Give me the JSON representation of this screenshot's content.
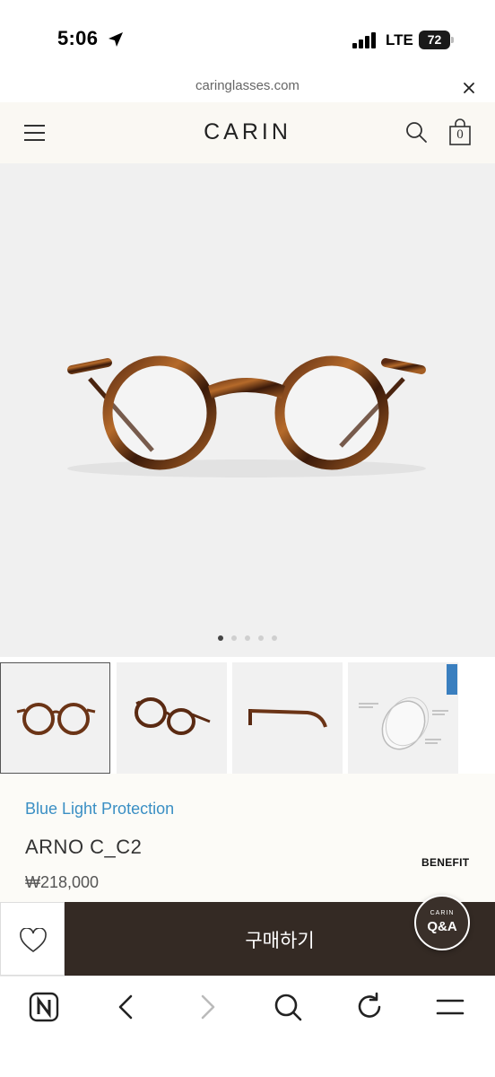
{
  "status": {
    "time": "5:06",
    "network": "LTE",
    "battery": "72"
  },
  "browser": {
    "url": "caringlasses.com"
  },
  "header": {
    "logo": "CARIN",
    "cart_count": "0"
  },
  "gallery": {
    "slide_count": 5,
    "active_index": 0,
    "thumbnail_count": 4,
    "selected_thumbnail": 0
  },
  "product": {
    "tagline": "Blue Light Protection",
    "name": "ARNO C_C2",
    "price": "₩218,000",
    "benefit_label": "BENEFIT"
  },
  "actions": {
    "buy_label": "구매하기",
    "qa_brand": "CARIN",
    "qa_label": "Q&A"
  },
  "icons": [
    "location-arrow-icon",
    "signal-icon",
    "battery-icon",
    "close-icon",
    "menu-icon",
    "search-icon",
    "cart-icon",
    "heart-icon",
    "naver-home-icon",
    "back-icon",
    "forward-icon",
    "toolbar-search-icon",
    "reload-icon",
    "toolbar-menu-icon"
  ],
  "colors": {
    "accent_blue": "#3a8fc4",
    "buy_bar": "#342a24",
    "header_bg": "#faf8f3",
    "hero_bg": "#f0f0f0"
  }
}
